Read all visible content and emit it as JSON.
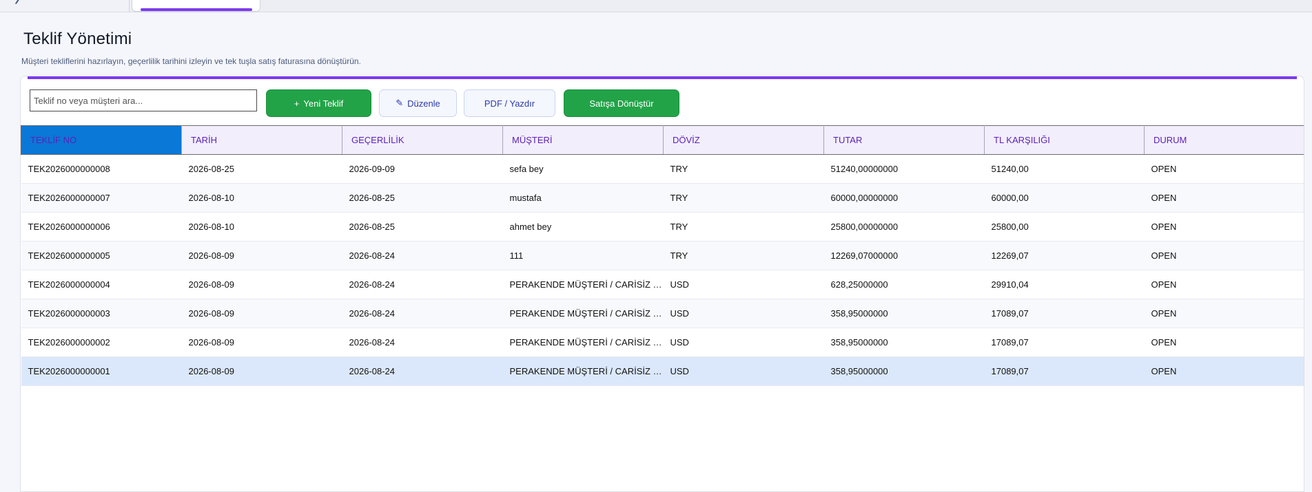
{
  "header": {
    "title": "Teklif Yönetimi",
    "subtitle": "Müşteri tekliflerini hazırlayın, geçerlilik tarihini izleyin ve tek tuşla satış faturasına dönüştürün."
  },
  "toolbar": {
    "search_placeholder": "Teklif no veya müşteri ara...",
    "new_icon": "+",
    "new_label": "Yeni Teklif",
    "edit_icon": "✎",
    "edit_label": "Düzenle",
    "pdf_label": "PDF / Yazdır",
    "convert_label": "Satışa Dönüştür"
  },
  "table": {
    "columns": [
      "TEKLİF NO",
      "TARİH",
      "GEÇERLİLİK",
      "MÜŞTERİ",
      "DÖVİZ",
      "TUTAR",
      "TL KARŞILIĞI",
      "DURUM"
    ],
    "rows": [
      [
        "TEK2026000000008",
        "2026-08-25",
        "2026-09-09",
        "sefa bey",
        "TRY",
        "51240,00000000",
        "51240,00",
        "OPEN"
      ],
      [
        "TEK2026000000007",
        "2026-08-10",
        "2026-08-25",
        "mustafa",
        "TRY",
        "60000,00000000",
        "60000,00",
        "OPEN"
      ],
      [
        "TEK2026000000006",
        "2026-08-10",
        "2026-08-25",
        "ahmet bey",
        "TRY",
        "25800,00000000",
        "25800,00",
        "OPEN"
      ],
      [
        "TEK2026000000005",
        "2026-08-09",
        "2026-08-24",
        "111",
        "TRY",
        "12269,07000000",
        "12269,07",
        "OPEN"
      ],
      [
        "TEK2026000000004",
        "2026-08-09",
        "2026-08-24",
        "PERAKENDE MÜŞTERİ / CARİSİZ S...",
        "USD",
        "628,25000000",
        "29910,04",
        "OPEN"
      ],
      [
        "TEK2026000000003",
        "2026-08-09",
        "2026-08-24",
        "PERAKENDE MÜŞTERİ / CARİSİZ S...",
        "USD",
        "358,95000000",
        "17089,07",
        "OPEN"
      ],
      [
        "TEK2026000000002",
        "2026-08-09",
        "2026-08-24",
        "PERAKENDE MÜŞTERİ / CARİSİZ S...",
        "USD",
        "358,95000000",
        "17089,07",
        "OPEN"
      ],
      [
        "TEK2026000000001",
        "2026-08-09",
        "2026-08-24",
        "PERAKENDE MÜŞTERİ / CARİSİZ S...",
        "USD",
        "358,95000000",
        "17089,07",
        "OPEN"
      ]
    ],
    "selected_row": 7
  }
}
